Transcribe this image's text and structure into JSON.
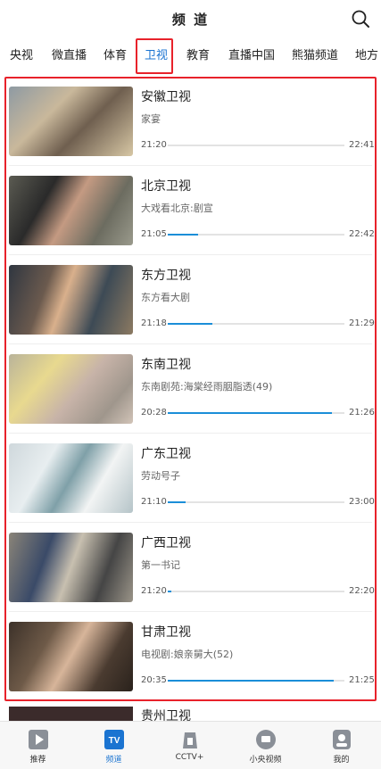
{
  "header": {
    "title": "频 道",
    "search_icon": "search-icon"
  },
  "tabs": [
    {
      "label": "央视",
      "active": false
    },
    {
      "label": "微直播",
      "active": false
    },
    {
      "label": "体育",
      "active": false
    },
    {
      "label": "卫视",
      "active": true
    },
    {
      "label": "教育",
      "active": false
    },
    {
      "label": "直播中国",
      "active": false
    },
    {
      "label": "熊猫频道",
      "active": false
    },
    {
      "label": "地方",
      "active": false
    }
  ],
  "channels": [
    {
      "name": "安徽卫视",
      "program": "家宴",
      "start": "21:20",
      "end": "22:41",
      "progress": 0.0
    },
    {
      "name": "北京卫视",
      "program": "大戏看北京:剧宣",
      "start": "21:05",
      "end": "22:42",
      "progress": 0.17
    },
    {
      "name": "东方卫视",
      "program": "东方看大剧",
      "start": "21:18",
      "end": "21:29",
      "progress": 0.25
    },
    {
      "name": "东南卫视",
      "program": "东南剧苑:海棠经雨胭脂透(49)",
      "start": "20:28",
      "end": "21:26",
      "progress": 0.93
    },
    {
      "name": "广东卫视",
      "program": "劳动号子",
      "start": "21:10",
      "end": "23:00",
      "progress": 0.1
    },
    {
      "name": "广西卫视",
      "program": "第一书记",
      "start": "21:20",
      "end": "22:20",
      "progress": 0.02
    },
    {
      "name": "甘肃卫视",
      "program": "电视剧:娘亲舅大(52)",
      "start": "20:35",
      "end": "21:25",
      "progress": 0.94
    }
  ],
  "partial_channel": {
    "name": "贵州卫视"
  },
  "bottom_nav": [
    {
      "label": "推荐",
      "icon": "play-icon",
      "active": false
    },
    {
      "label": "频道",
      "icon": "tv-icon",
      "active": true
    },
    {
      "label": "CCTV+",
      "icon": "cctv-plus-icon",
      "active": false
    },
    {
      "label": "小央视频",
      "icon": "yang-video-icon",
      "active": false
    },
    {
      "label": "我的",
      "icon": "profile-icon",
      "active": false
    }
  ],
  "colors": {
    "accent": "#1b74d1",
    "highlight": "#e8222b",
    "progress": "#1b8ed8"
  }
}
